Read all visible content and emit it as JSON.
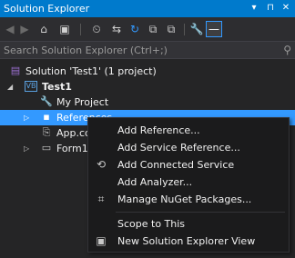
{
  "window": {
    "title": "Solution Explorer",
    "title_buttons": [
      "▾",
      "⊓",
      "✕"
    ]
  },
  "toolbar": {
    "back_glyph": "◀",
    "forward_glyph": "▶",
    "home_glyph": "⌂",
    "switch_views_glyph": "▣",
    "history_glyph": "⏲",
    "sync_glyph": "⇆",
    "refresh_glyph": "↻",
    "collapse_glyph": "⧉",
    "show_all_glyph": "⧉",
    "properties_glyph": "🔧",
    "preview_glyph": "—"
  },
  "search": {
    "placeholder": "Search Solution Explorer (Ctrl+;)",
    "icon": "search-icon"
  },
  "tree": {
    "solution": "Solution 'Test1' (1 project)",
    "project": "Test1",
    "my_project": "My Project",
    "references": "References",
    "app_config": "App.co",
    "form1": "Form1."
  },
  "context_menu": {
    "items": [
      {
        "label": "Add Reference...",
        "icon": ""
      },
      {
        "label": "Add Service Reference...",
        "icon": ""
      },
      {
        "label": "Add Connected Service",
        "icon": "connected-service-icon"
      },
      {
        "label": "Add Analyzer...",
        "icon": ""
      },
      {
        "label": "Manage NuGet Packages...",
        "icon": "nuget-icon"
      },
      {
        "label": "Scope to This",
        "icon": ""
      },
      {
        "label": "New Solution Explorer View",
        "icon": "new-view-icon"
      }
    ]
  },
  "colors": {
    "accent": "#007acc",
    "selection": "#3399ff",
    "background": "#252526",
    "menu_background": "#1b1b1c"
  }
}
